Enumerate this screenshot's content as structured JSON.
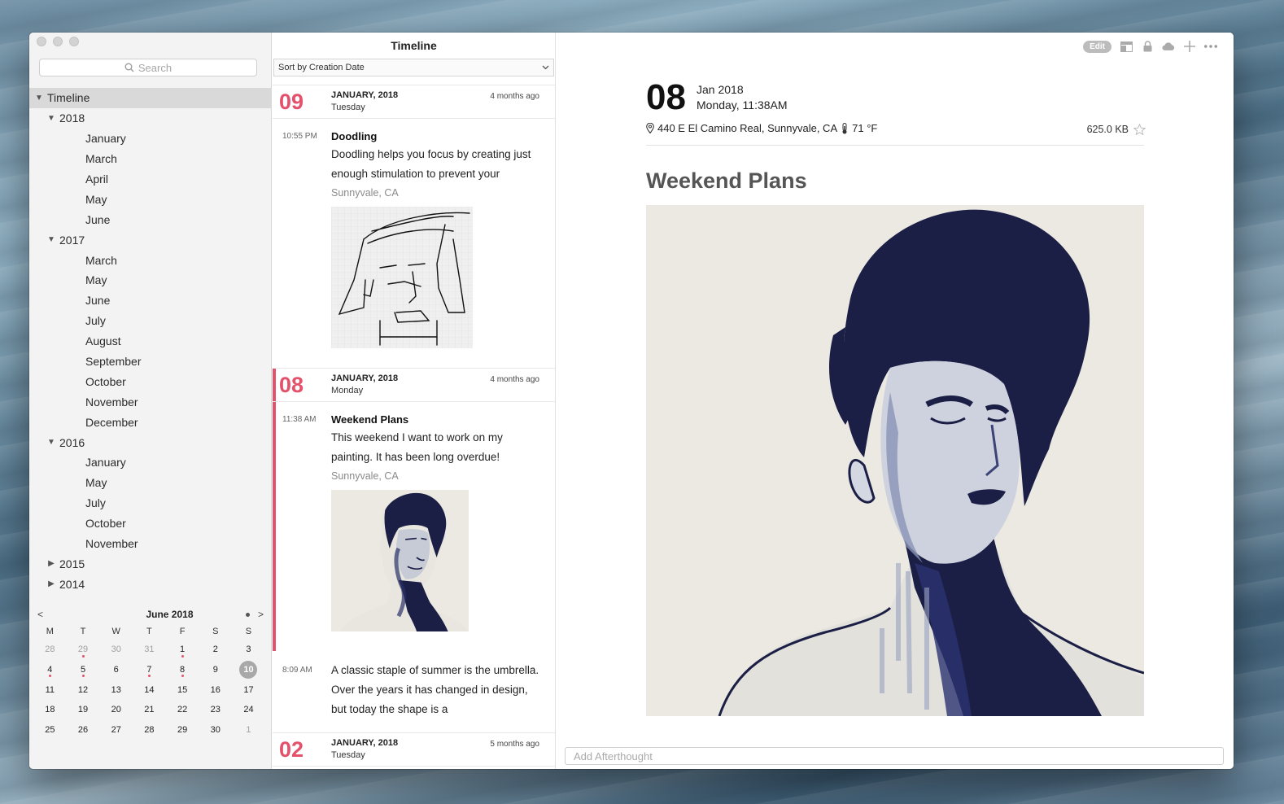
{
  "sidebar": {
    "search_placeholder": "Search",
    "tree": {
      "root": "Timeline",
      "years": [
        {
          "year": "2018",
          "expanded": true,
          "months": [
            "January",
            "March",
            "April",
            "May",
            "June"
          ]
        },
        {
          "year": "2017",
          "expanded": true,
          "months": [
            "March",
            "May",
            "June",
            "July",
            "August",
            "September",
            "October",
            "November",
            "December"
          ]
        },
        {
          "year": "2016",
          "expanded": true,
          "months": [
            "January",
            "May",
            "July",
            "October",
            "November"
          ]
        },
        {
          "year": "2015",
          "expanded": false,
          "months": []
        },
        {
          "year": "2014",
          "expanded": false,
          "months": []
        }
      ]
    },
    "calendar": {
      "prev": "<",
      "next": ">",
      "title": "June 2018",
      "weekdays": [
        "M",
        "T",
        "W",
        "T",
        "F",
        "S",
        "S"
      ],
      "weeks": [
        [
          "28",
          "29",
          "30",
          "31",
          "1",
          "2",
          "3"
        ],
        [
          "4",
          "5",
          "6",
          "7",
          "8",
          "9",
          "10"
        ],
        [
          "11",
          "12",
          "13",
          "14",
          "15",
          "16",
          "17"
        ],
        [
          "18",
          "19",
          "20",
          "21",
          "22",
          "23",
          "24"
        ],
        [
          "25",
          "26",
          "27",
          "28",
          "29",
          "30",
          "1"
        ]
      ],
      "today": "10",
      "accent_color": "#e5506a"
    }
  },
  "list": {
    "title": "Timeline",
    "sort_label": "Sort by Creation Date",
    "days": [
      {
        "num": "09",
        "month": "JANUARY, 2018",
        "weekday": "Tuesday",
        "ago": "4 months ago"
      },
      {
        "num": "08",
        "month": "JANUARY, 2018",
        "weekday": "Monday",
        "ago": "4 months ago"
      },
      {
        "num": "02",
        "month": "JANUARY, 2018",
        "weekday": "Tuesday",
        "ago": "5 months ago"
      }
    ],
    "entries": [
      {
        "time": "10:55 PM",
        "title": "Doodling",
        "body": "Doodling helps you focus by creating just enough stimulation to prevent your",
        "location": "Sunnyvale, CA"
      },
      {
        "time": "11:38 AM",
        "title": "Weekend Plans",
        "body": "This weekend I want to work on my painting. It has been long overdue!",
        "location": "Sunnyvale, CA"
      },
      {
        "time": "8:09 AM",
        "title": "",
        "body": "A classic staple of summer is the umbrella. Over the years it has changed in design, but today the shape is a",
        "location": ""
      }
    ]
  },
  "detail": {
    "edit_label": "Edit",
    "day": "08",
    "month_year": "Jan 2018",
    "weekday_time": "Monday, 11:38AM",
    "location": "440 E El Camino Real, Sunnyvale, CA",
    "temperature": "71 °F",
    "size": "625.0 KB",
    "title": "Weekend Plans",
    "afterthought_placeholder": "Add Afterthought"
  }
}
